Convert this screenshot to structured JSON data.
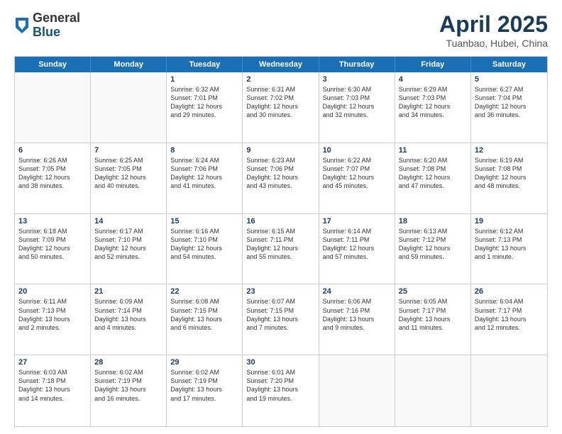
{
  "header": {
    "logo": {
      "general": "General",
      "blue": "Blue"
    },
    "title": "April 2025",
    "location": "Tuanbao, Hubei, China"
  },
  "calendar": {
    "days": [
      "Sunday",
      "Monday",
      "Tuesday",
      "Wednesday",
      "Thursday",
      "Friday",
      "Saturday"
    ],
    "weeks": [
      [
        {
          "day": "",
          "lines": []
        },
        {
          "day": "",
          "lines": []
        },
        {
          "day": "1",
          "lines": [
            "Sunrise: 6:32 AM",
            "Sunset: 7:01 PM",
            "Daylight: 12 hours",
            "and 29 minutes."
          ]
        },
        {
          "day": "2",
          "lines": [
            "Sunrise: 6:31 AM",
            "Sunset: 7:02 PM",
            "Daylight: 12 hours",
            "and 30 minutes."
          ]
        },
        {
          "day": "3",
          "lines": [
            "Sunrise: 6:30 AM",
            "Sunset: 7:03 PM",
            "Daylight: 12 hours",
            "and 32 minutes."
          ]
        },
        {
          "day": "4",
          "lines": [
            "Sunrise: 6:29 AM",
            "Sunset: 7:03 PM",
            "Daylight: 12 hours",
            "and 34 minutes."
          ]
        },
        {
          "day": "5",
          "lines": [
            "Sunrise: 6:27 AM",
            "Sunset: 7:04 PM",
            "Daylight: 12 hours",
            "and 36 minutes."
          ]
        }
      ],
      [
        {
          "day": "6",
          "lines": [
            "Sunrise: 6:26 AM",
            "Sunset: 7:05 PM",
            "Daylight: 12 hours",
            "and 38 minutes."
          ]
        },
        {
          "day": "7",
          "lines": [
            "Sunrise: 6:25 AM",
            "Sunset: 7:05 PM",
            "Daylight: 12 hours",
            "and 40 minutes."
          ]
        },
        {
          "day": "8",
          "lines": [
            "Sunrise: 6:24 AM",
            "Sunset: 7:06 PM",
            "Daylight: 12 hours",
            "and 41 minutes."
          ]
        },
        {
          "day": "9",
          "lines": [
            "Sunrise: 6:23 AM",
            "Sunset: 7:06 PM",
            "Daylight: 12 hours",
            "and 43 minutes."
          ]
        },
        {
          "day": "10",
          "lines": [
            "Sunrise: 6:22 AM",
            "Sunset: 7:07 PM",
            "Daylight: 12 hours",
            "and 45 minutes."
          ]
        },
        {
          "day": "11",
          "lines": [
            "Sunrise: 6:20 AM",
            "Sunset: 7:08 PM",
            "Daylight: 12 hours",
            "and 47 minutes."
          ]
        },
        {
          "day": "12",
          "lines": [
            "Sunrise: 6:19 AM",
            "Sunset: 7:08 PM",
            "Daylight: 12 hours",
            "and 48 minutes."
          ]
        }
      ],
      [
        {
          "day": "13",
          "lines": [
            "Sunrise: 6:18 AM",
            "Sunset: 7:09 PM",
            "Daylight: 12 hours",
            "and 50 minutes."
          ]
        },
        {
          "day": "14",
          "lines": [
            "Sunrise: 6:17 AM",
            "Sunset: 7:10 PM",
            "Daylight: 12 hours",
            "and 52 minutes."
          ]
        },
        {
          "day": "15",
          "lines": [
            "Sunrise: 6:16 AM",
            "Sunset: 7:10 PM",
            "Daylight: 12 hours",
            "and 54 minutes."
          ]
        },
        {
          "day": "16",
          "lines": [
            "Sunrise: 6:15 AM",
            "Sunset: 7:11 PM",
            "Daylight: 12 hours",
            "and 55 minutes."
          ]
        },
        {
          "day": "17",
          "lines": [
            "Sunrise: 6:14 AM",
            "Sunset: 7:11 PM",
            "Daylight: 12 hours",
            "and 57 minutes."
          ]
        },
        {
          "day": "18",
          "lines": [
            "Sunrise: 6:13 AM",
            "Sunset: 7:12 PM",
            "Daylight: 12 hours",
            "and 59 minutes."
          ]
        },
        {
          "day": "19",
          "lines": [
            "Sunrise: 6:12 AM",
            "Sunset: 7:13 PM",
            "Daylight: 13 hours",
            "and 1 minute."
          ]
        }
      ],
      [
        {
          "day": "20",
          "lines": [
            "Sunrise: 6:11 AM",
            "Sunset: 7:13 PM",
            "Daylight: 13 hours",
            "and 2 minutes."
          ]
        },
        {
          "day": "21",
          "lines": [
            "Sunrise: 6:09 AM",
            "Sunset: 7:14 PM",
            "Daylight: 13 hours",
            "and 4 minutes."
          ]
        },
        {
          "day": "22",
          "lines": [
            "Sunrise: 6:08 AM",
            "Sunset: 7:15 PM",
            "Daylight: 13 hours",
            "and 6 minutes."
          ]
        },
        {
          "day": "23",
          "lines": [
            "Sunrise: 6:07 AM",
            "Sunset: 7:15 PM",
            "Daylight: 13 hours",
            "and 7 minutes."
          ]
        },
        {
          "day": "24",
          "lines": [
            "Sunrise: 6:06 AM",
            "Sunset: 7:16 PM",
            "Daylight: 13 hours",
            "and 9 minutes."
          ]
        },
        {
          "day": "25",
          "lines": [
            "Sunrise: 6:05 AM",
            "Sunset: 7:17 PM",
            "Daylight: 13 hours",
            "and 11 minutes."
          ]
        },
        {
          "day": "26",
          "lines": [
            "Sunrise: 6:04 AM",
            "Sunset: 7:17 PM",
            "Daylight: 13 hours",
            "and 12 minutes."
          ]
        }
      ],
      [
        {
          "day": "27",
          "lines": [
            "Sunrise: 6:03 AM",
            "Sunset: 7:18 PM",
            "Daylight: 13 hours",
            "and 14 minutes."
          ]
        },
        {
          "day": "28",
          "lines": [
            "Sunrise: 6:02 AM",
            "Sunset: 7:19 PM",
            "Daylight: 13 hours",
            "and 16 minutes."
          ]
        },
        {
          "day": "29",
          "lines": [
            "Sunrise: 6:02 AM",
            "Sunset: 7:19 PM",
            "Daylight: 13 hours",
            "and 17 minutes."
          ]
        },
        {
          "day": "30",
          "lines": [
            "Sunrise: 6:01 AM",
            "Sunset: 7:20 PM",
            "Daylight: 13 hours",
            "and 19 minutes."
          ]
        },
        {
          "day": "",
          "lines": []
        },
        {
          "day": "",
          "lines": []
        },
        {
          "day": "",
          "lines": []
        }
      ]
    ]
  }
}
